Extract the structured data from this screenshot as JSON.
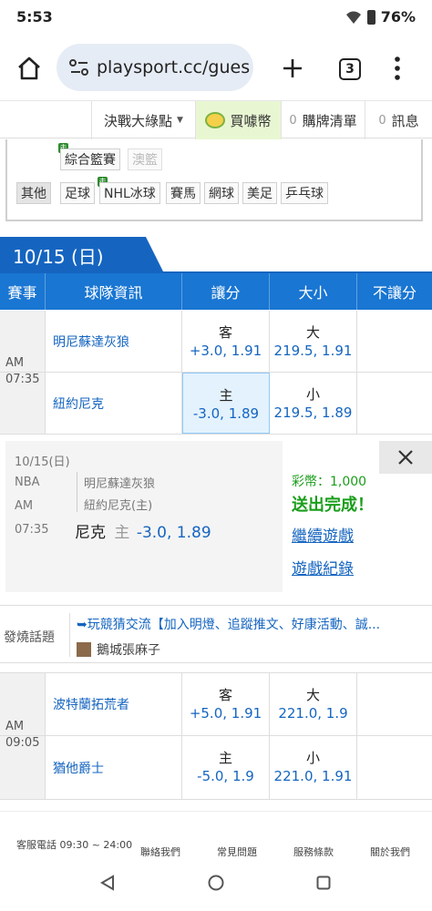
{
  "status": {
    "time": "5:53",
    "battery": "76%"
  },
  "browser": {
    "url": "playsport.cc/gues",
    "tab_count": "3"
  },
  "site_nav": {
    "items": [
      {
        "label": "決戰大綠點",
        "count": ""
      },
      {
        "label": "買噱幣",
        "count": ""
      },
      {
        "label": "購牌清單",
        "count": "0"
      },
      {
        "label": "訊息",
        "count": "0"
      }
    ]
  },
  "filters": {
    "row1": [
      {
        "label": "綜合籃賽",
        "badge": "走"
      },
      {
        "label": "澳籃"
      }
    ],
    "row2": [
      {
        "label": "其他"
      },
      {
        "label": "足球"
      },
      {
        "label": "NHL冰球",
        "badge": "走"
      },
      {
        "label": "賽馬"
      },
      {
        "label": "網球"
      },
      {
        "label": "美足"
      },
      {
        "label": "乒乓球"
      }
    ]
  },
  "date_label": "10/15 (日)",
  "table_headers": [
    "賽事",
    "球隊資訊",
    "讓分",
    "大小",
    "不讓分"
  ],
  "games": [
    {
      "ampm": "AM",
      "time": "07:35",
      "away": {
        "team": "明尼蘇達灰狼",
        "spread_label": "客",
        "spread": "+3.0, 1.91",
        "total_label": "大",
        "total": "219.5, 1.91"
      },
      "home": {
        "team": "紐約尼克",
        "spread_label": "主",
        "spread": "-3.0, 1.89",
        "total_label": "小",
        "total": "219.5, 1.89"
      }
    },
    {
      "ampm": "AM",
      "time": "09:05",
      "away": {
        "team": "波特蘭拓荒者",
        "spread_label": "客",
        "spread": "+5.0, 1.91",
        "total_label": "大",
        "total": "221.0, 1.9"
      },
      "home": {
        "team": "猶他爵士",
        "spread_label": "主",
        "spread": "-5.0, 1.9",
        "total_label": "小",
        "total": "221.0, 1.91"
      }
    }
  ],
  "popup": {
    "date": "10/15(日)",
    "league": "NBA",
    "ampm": "AM",
    "time": "07:35",
    "team1": "明尼蘇達灰狼",
    "team2": "紐約尼克(主)",
    "pick_team": "尼克",
    "pick_side": "主",
    "pick_odds": "-3.0, 1.89",
    "coins": "彩幣：1,000",
    "sent": "送出完成！",
    "continue": "繼續遊戲",
    "history": "遊戲紀錄"
  },
  "discussion": {
    "label": "發燒話題",
    "title": "➥玩競猜交流【加入明燈、追蹤推文、好康活動、誠...",
    "author": "鵝城張麻子"
  },
  "footer": {
    "phone": "客服電話 09:30 ~ 24:00",
    "links": [
      "聯絡我們",
      "常見問題",
      "服務條款",
      "關於我們"
    ]
  },
  "colors": {
    "brand_blue": "#1976d2",
    "header_blue": "#1565c0",
    "success_green": "#1a9e1a",
    "link_blue": "#1565c0"
  }
}
